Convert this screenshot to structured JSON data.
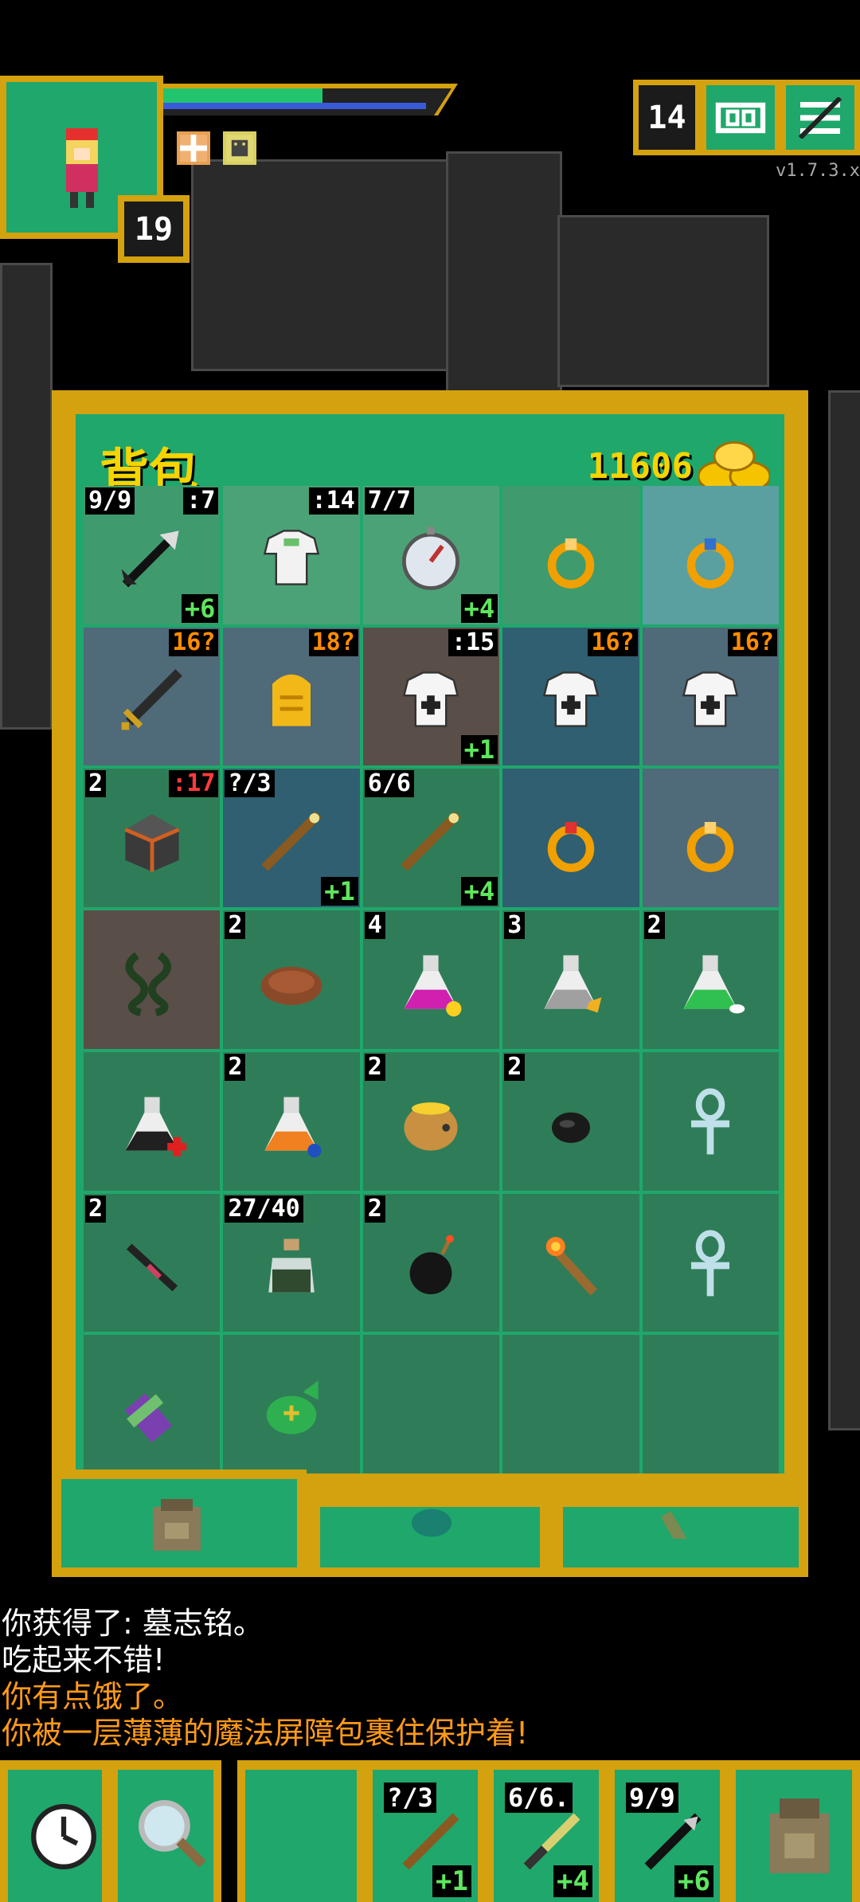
{
  "hero": {
    "level": "19"
  },
  "top_buttons": {
    "depth": "14",
    "journal_icon": "journal-icon",
    "menu_icon": "menu-icon"
  },
  "version": "v1.7.3.x",
  "backpack": {
    "title": "背包",
    "gold": "11606",
    "cells": [
      {
        "icon": "arrows-icon",
        "qty": "9/9",
        "lvl": ":7",
        "lvl_color": "white",
        "upg": "+6",
        "bg": "#3f9a6d"
      },
      {
        "icon": "cloth-armor-icon",
        "qty": "",
        "lvl": ":14",
        "lvl_color": "white",
        "upg": "",
        "bg": "#4ba276"
      },
      {
        "icon": "compass-icon",
        "qty": "7/7",
        "lvl": "",
        "lvl_color": "white",
        "upg": "+4",
        "bg": "#4ba276"
      },
      {
        "icon": "ring-icon",
        "qty": "",
        "lvl": "",
        "lvl_color": "white",
        "upg": "",
        "bg": "#3f9a6d"
      },
      {
        "icon": "ring-blue-icon",
        "qty": "",
        "lvl": "",
        "lvl_color": "white",
        "upg": "",
        "bg": "#5aa0a0"
      },
      {
        "icon": "sword-icon",
        "qty": "",
        "lvl": "16?",
        "lvl_color": "orange",
        "upg": "",
        "bg": "#4f6a78"
      },
      {
        "icon": "tombstone-icon",
        "qty": "",
        "lvl": "18?",
        "lvl_color": "orange",
        "upg": "",
        "bg": "#4f6a78"
      },
      {
        "icon": "armor-icon",
        "qty": "",
        "lvl": ":15",
        "lvl_color": "white",
        "upg": "+1",
        "bg": "#5a4e48"
      },
      {
        "icon": "armor-icon",
        "qty": "",
        "lvl": "16?",
        "lvl_color": "orange",
        "upg": "",
        "bg": "#2f5f70"
      },
      {
        "icon": "armor-icon",
        "qty": "",
        "lvl": "16?",
        "lvl_color": "orange",
        "upg": "",
        "bg": "#4f6a78"
      },
      {
        "icon": "helmet-icon",
        "qty": "2",
        "lvl": ":17",
        "lvl_color": "red",
        "upg": "",
        "bg": "#2f7d58"
      },
      {
        "icon": "wand-icon",
        "qty": "?/3",
        "lvl": "",
        "lvl_color": "white",
        "upg": "+1",
        "bg": "#2f5f70"
      },
      {
        "icon": "wand-icon",
        "qty": "6/6",
        "lvl": "",
        "lvl_color": "white",
        "upg": "+4",
        "bg": "#2f7d58"
      },
      {
        "icon": "ring-red-icon",
        "qty": "",
        "lvl": "",
        "lvl_color": "white",
        "upg": "",
        "bg": "#2f5f70"
      },
      {
        "icon": "ring-icon",
        "qty": "",
        "lvl": "",
        "lvl_color": "white",
        "upg": "",
        "bg": "#4f6a78"
      },
      {
        "icon": "chain-icon",
        "qty": "",
        "lvl": "",
        "lvl_color": "white",
        "upg": "",
        "bg": "#5a4e48"
      },
      {
        "icon": "meat-icon",
        "qty": "2",
        "lvl": "",
        "lvl_color": "white",
        "upg": "",
        "bg": "#2f7d58"
      },
      {
        "icon": "potion-magenta-icon",
        "qty": "4",
        "lvl": "",
        "lvl_color": "white",
        "upg": "",
        "bg": "#2f7d58"
      },
      {
        "icon": "potion-grey-icon",
        "qty": "3",
        "lvl": "",
        "lvl_color": "white",
        "upg": "",
        "bg": "#2f7d58"
      },
      {
        "icon": "potion-green-icon",
        "qty": "2",
        "lvl": "",
        "lvl_color": "white",
        "upg": "",
        "bg": "#2f7d58"
      },
      {
        "icon": "potion-black-icon",
        "qty": "",
        "lvl": "",
        "lvl_color": "white",
        "upg": "",
        "bg": "#2f7d58"
      },
      {
        "icon": "potion-orange-icon",
        "qty": "2",
        "lvl": "",
        "lvl_color": "white",
        "upg": "",
        "bg": "#2f7d58"
      },
      {
        "icon": "honey-pot-icon",
        "qty": "2",
        "lvl": "",
        "lvl_color": "white",
        "upg": "",
        "bg": "#2f7d58"
      },
      {
        "icon": "stone-icon",
        "qty": "2",
        "lvl": "",
        "lvl_color": "white",
        "upg": "",
        "bg": "#2f7d58"
      },
      {
        "icon": "ankh-icon",
        "qty": "",
        "lvl": "",
        "lvl_color": "white",
        "upg": "",
        "bg": "#2f7d58"
      },
      {
        "icon": "dart-icon",
        "qty": "2",
        "lvl": "",
        "lvl_color": "white",
        "upg": "",
        "bg": "#2f7d58"
      },
      {
        "icon": "dew-vial-icon",
        "qty": "27/40",
        "lvl": "",
        "lvl_color": "white",
        "upg": "",
        "bg": "#2f7d58"
      },
      {
        "icon": "bomb-icon",
        "qty": "2",
        "lvl": "",
        "lvl_color": "white",
        "upg": "",
        "bg": "#2f7d58"
      },
      {
        "icon": "torch-icon",
        "qty": "",
        "lvl": "",
        "lvl_color": "white",
        "upg": "",
        "bg": "#2f7d58"
      },
      {
        "icon": "ankh-icon",
        "qty": "",
        "lvl": "",
        "lvl_color": "white",
        "upg": "",
        "bg": "#2f7d58"
      },
      {
        "icon": "scroll-holder-icon",
        "qty": "",
        "lvl": "",
        "lvl_color": "white",
        "upg": "",
        "bg": "#2f7d58"
      },
      {
        "icon": "seed-pouch-icon",
        "qty": "",
        "lvl": "",
        "lvl_color": "white",
        "upg": "",
        "bg": "#2f7d58"
      },
      {
        "icon": "",
        "qty": "",
        "lvl": "",
        "lvl_color": "white",
        "upg": "",
        "bg": "#2f7d58"
      },
      {
        "icon": "",
        "qty": "",
        "lvl": "",
        "lvl_color": "white",
        "upg": "",
        "bg": "#2f7d58"
      },
      {
        "icon": "",
        "qty": "",
        "lvl": "",
        "lvl_color": "white",
        "upg": "",
        "bg": "#2f7d58"
      }
    ]
  },
  "log": [
    {
      "text": "你获得了: 墓志铭。",
      "color": "#ffffff"
    },
    {
      "text": "吃起来不错!",
      "color": "#ffffff"
    },
    {
      "text": "你有点饿了。",
      "color": "#ff9a1a"
    },
    {
      "text": "你被一层薄薄的魔法屏障包裹住保护着!",
      "color": "#ff9a1a"
    }
  ],
  "quickslots": [
    {
      "qty": "?/3",
      "upg": "+1"
    },
    {
      "qty": "6/6.",
      "upg": "+4"
    },
    {
      "qty": "9/9",
      "upg": "+6"
    }
  ]
}
